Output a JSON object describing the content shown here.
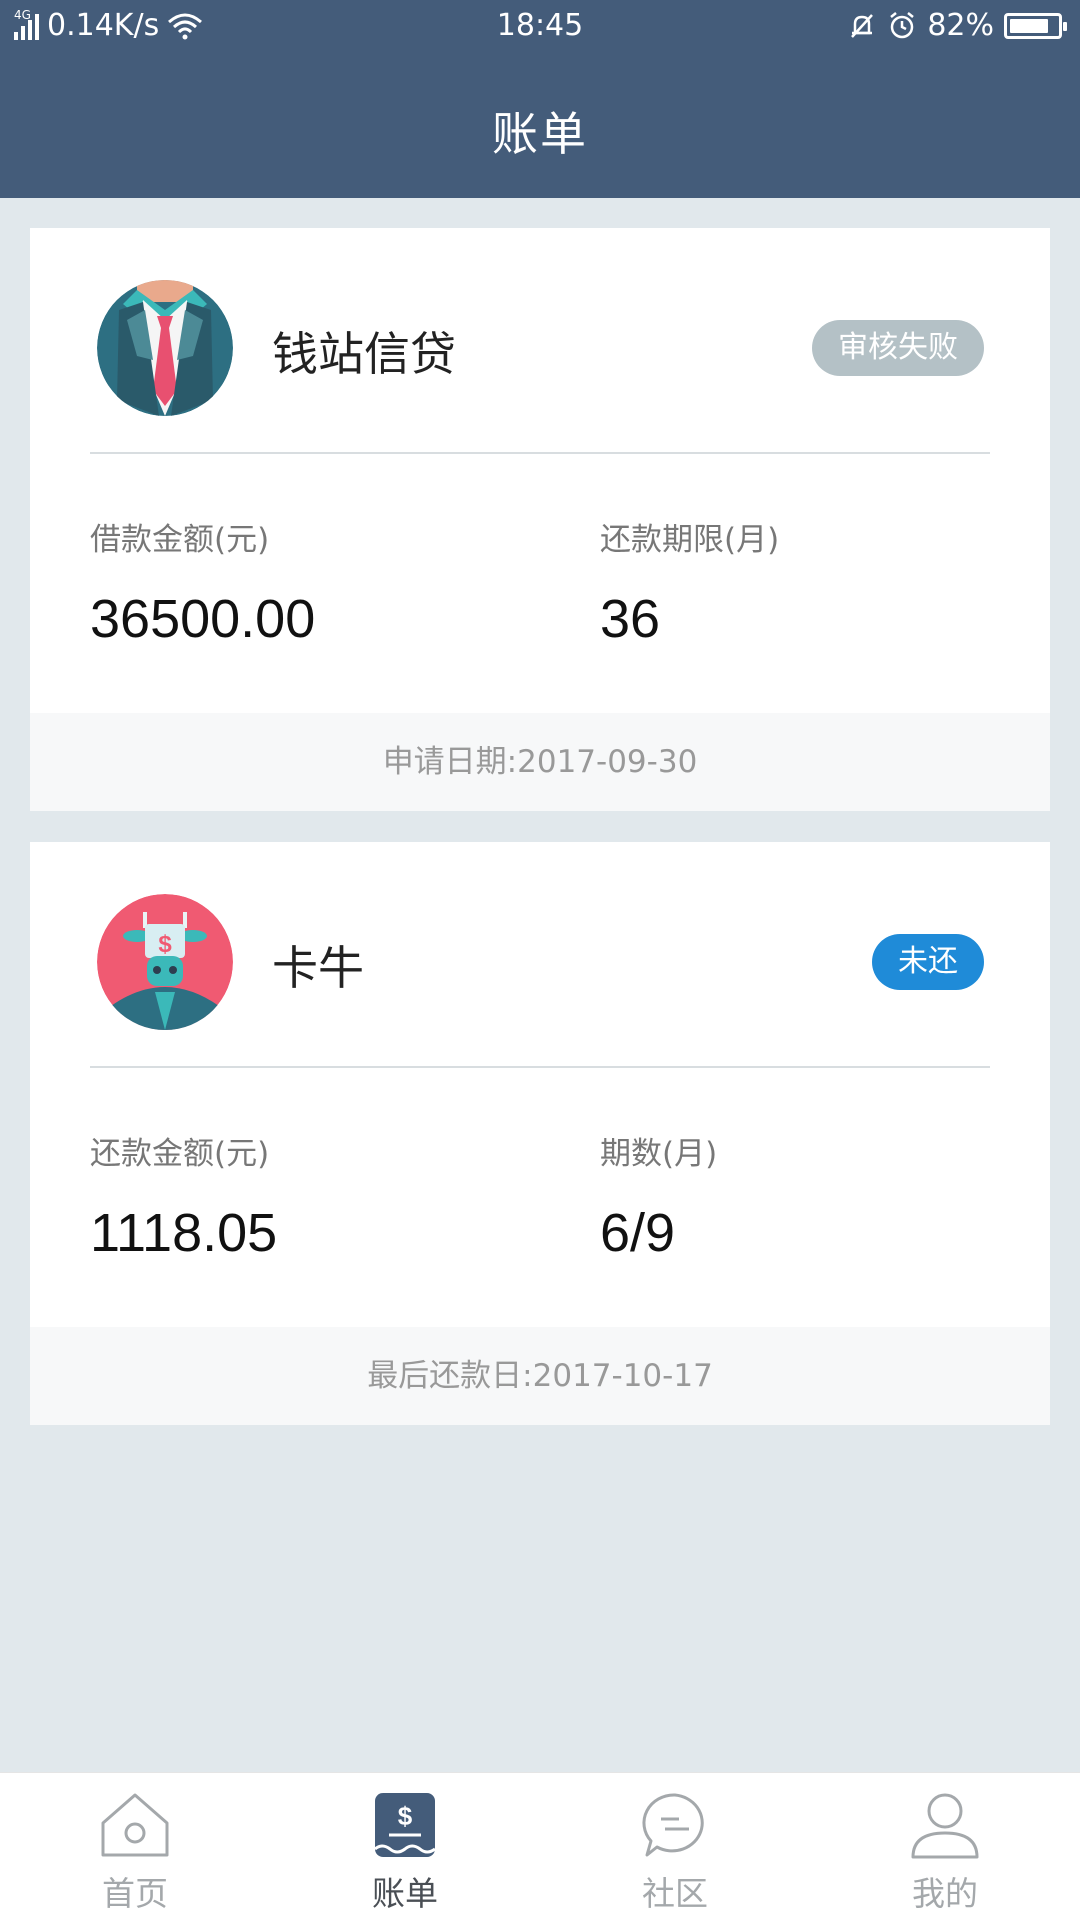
{
  "status_bar": {
    "network": "4G",
    "speed": "0.14K/s",
    "time": "18:45",
    "battery": "82%",
    "battery_level": 0.82
  },
  "header": {
    "title": "账单"
  },
  "bills": [
    {
      "lender": "钱站信贷",
      "status": "审核失败",
      "status_color": "#b4c1c6",
      "left_label": "借款金额(元)",
      "left_value": "36500.00",
      "right_label": "还款期限(月)",
      "right_value": "36",
      "footer": "申请日期:2017-09-30"
    },
    {
      "lender": "卡牛",
      "status": "未还",
      "status_color": "#1f8bd8",
      "left_label": "还款金额(元)",
      "left_value": "1118.05",
      "right_label": "期数(月)",
      "right_value": "6/9",
      "footer": "最后还款日:2017-10-17"
    }
  ],
  "tabbar": {
    "items": [
      {
        "label": "首页",
        "icon": "home-icon"
      },
      {
        "label": "账单",
        "icon": "bill-icon",
        "active": true
      },
      {
        "label": "社区",
        "icon": "community-chat-icon"
      },
      {
        "label": "我的",
        "icon": "profile-icon"
      }
    ]
  },
  "colors": {
    "header_bg": "#445c7a",
    "page_bg": "#e1e8ec",
    "tab_active": "#4a4f55",
    "tab_inactive": "#a4a8ab"
  }
}
